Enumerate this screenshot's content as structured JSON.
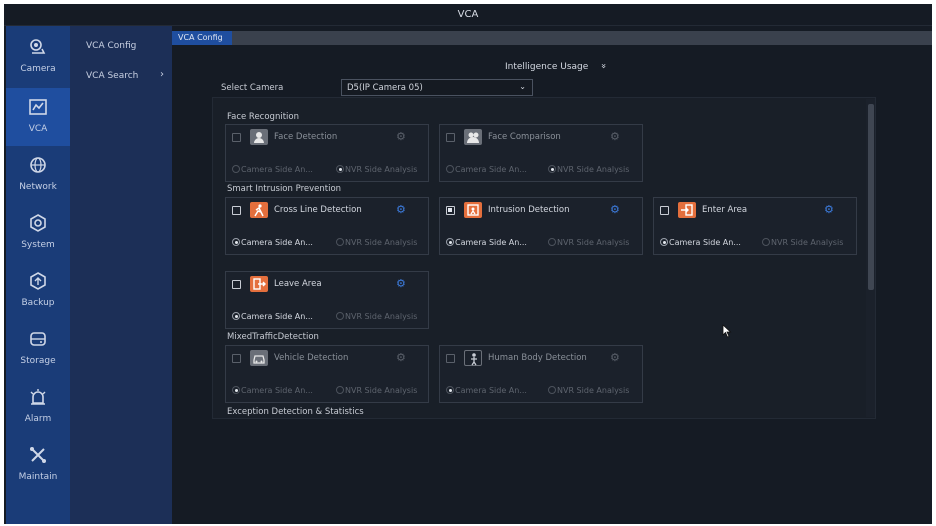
{
  "window": {
    "title": "VCA"
  },
  "sidebar": {
    "items": [
      {
        "label": "Camera",
        "icon": "camera-icon"
      },
      {
        "label": "VCA",
        "icon": "vca-icon",
        "active": true
      },
      {
        "label": "Network",
        "icon": "network-icon"
      },
      {
        "label": "System",
        "icon": "system-icon"
      },
      {
        "label": "Backup",
        "icon": "backup-icon"
      },
      {
        "label": "Storage",
        "icon": "storage-icon"
      },
      {
        "label": "Alarm",
        "icon": "alarm-icon"
      },
      {
        "label": "Maintain",
        "icon": "maintain-icon"
      }
    ]
  },
  "submenu": {
    "items": [
      {
        "label": "VCA Config",
        "active": true
      },
      {
        "label": "VCA Search",
        "chevron": "›"
      }
    ]
  },
  "tab": {
    "label": "VCA Config"
  },
  "usage": {
    "label": "Intelligence Usage",
    "chevron": "»"
  },
  "camera_select": {
    "label": "Select Camera",
    "value": "D5(IP Camera 05)",
    "chevron": "⌄"
  },
  "sections": {
    "face": "Face Recognition",
    "smart": "Smart Intrusion Prevention",
    "mixed": "MixedTrafficDetection",
    "exception": "Exception Detection & Statistics"
  },
  "options": {
    "camera_side": "Camera Side An...",
    "nvr_side": "NVR Side Analysis"
  },
  "functions": {
    "face_detection": {
      "label": "Face Detection",
      "checked": false,
      "enabled": false,
      "selected": "nvr"
    },
    "face_comparison": {
      "label": "Face Comparison",
      "checked": false,
      "enabled": false,
      "selected": "nvr"
    },
    "cross_line": {
      "label": "Cross Line Detection",
      "checked": false,
      "enabled": true,
      "selected": "camera"
    },
    "intrusion": {
      "label": "Intrusion Detection",
      "checked": true,
      "enabled": true,
      "selected": "camera"
    },
    "enter_area": {
      "label": "Enter Area",
      "checked": false,
      "enabled": true,
      "selected": "camera"
    },
    "leave_area": {
      "label": "Leave Area",
      "checked": false,
      "enabled": true,
      "selected": "camera"
    },
    "vehicle": {
      "label": "Vehicle Detection",
      "checked": false,
      "enabled": false,
      "selected": "camera"
    },
    "human_body": {
      "label": "Human Body Detection",
      "checked": false,
      "enabled": false,
      "selected": "camera"
    }
  },
  "colors": {
    "accent": "#1f4e9f",
    "sidebar": "#1a3c78",
    "submenu": "#1c2f57",
    "function_icon": "#e46f3d",
    "gear": "#3d7de0"
  }
}
